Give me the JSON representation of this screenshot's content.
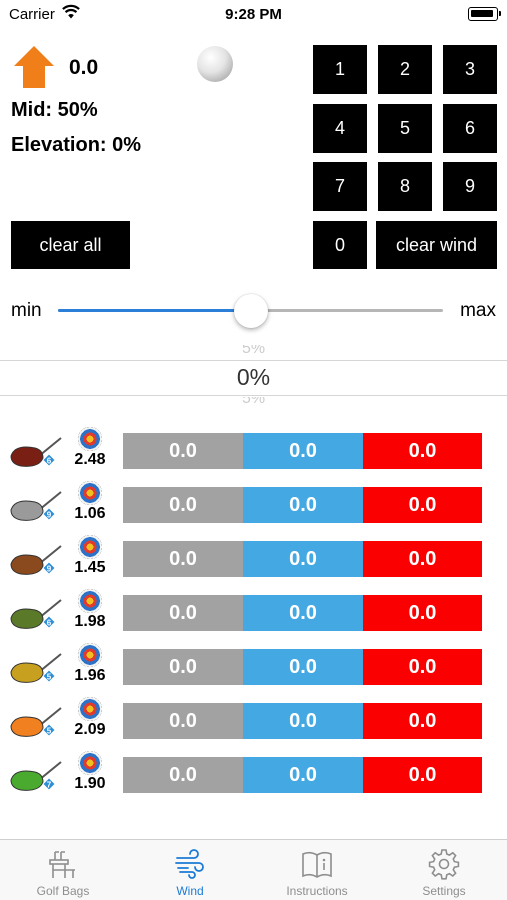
{
  "status_bar": {
    "carrier": "Carrier",
    "time": "9:28 PM"
  },
  "wind": {
    "arrow_icon": "wind-direction-arrow-icon",
    "arrow_color": "#f07f1a",
    "value": "0.0",
    "ball_icon": "golf-ball-icon",
    "mid": "Mid: 50%",
    "elevation": "Elevation: 0%"
  },
  "buttons": {
    "clear_all": "clear all",
    "clear_wind": "clear wind"
  },
  "keypad": [
    "1",
    "2",
    "3",
    "4",
    "5",
    "6",
    "7",
    "8",
    "9",
    "0"
  ],
  "slider": {
    "min_label": "min",
    "max_label": "max",
    "value": 0.5
  },
  "picker": {
    "above": "5%",
    "selected": "0%",
    "below": "5%"
  },
  "clubs": [
    {
      "icon": "driver-club-icon",
      "badge": "6",
      "value": "2.48",
      "cells": [
        "0.0",
        "0.0",
        "0.0"
      ]
    },
    {
      "icon": "wood-club-icon",
      "badge": "9",
      "value": "1.06",
      "cells": [
        "0.0",
        "0.0",
        "0.0"
      ]
    },
    {
      "icon": "hybrid-club-icon",
      "badge": "9",
      "value": "1.45",
      "cells": [
        "0.0",
        "0.0",
        "0.0"
      ]
    },
    {
      "icon": "iron-club-icon",
      "badge": "6",
      "value": "1.98",
      "cells": [
        "0.0",
        "0.0",
        "0.0"
      ]
    },
    {
      "icon": "iron-club-icon",
      "badge": "5",
      "value": "1.96",
      "cells": [
        "0.0",
        "0.0",
        "0.0"
      ]
    },
    {
      "icon": "wedge-club-icon",
      "badge": "5",
      "value": "2.09",
      "cells": [
        "0.0",
        "0.0",
        "0.0"
      ]
    },
    {
      "icon": "wedge-club-icon",
      "badge": "7",
      "value": "1.90",
      "cells": [
        "0.0",
        "0.0",
        "0.0"
      ]
    }
  ],
  "tabs": [
    {
      "label": "Golf Bags",
      "icon": "golf-bag-icon",
      "active": false
    },
    {
      "label": "Wind",
      "icon": "wind-icon",
      "active": true
    },
    {
      "label": "Instructions",
      "icon": "book-icon",
      "active": false
    },
    {
      "label": "Settings",
      "icon": "gear-icon",
      "active": false
    }
  ],
  "colors": {
    "accent": "#1a7bd6",
    "gray_cell": "#a2a2a2",
    "blue_cell": "#44a8e2",
    "red_cell": "#fa0000"
  }
}
